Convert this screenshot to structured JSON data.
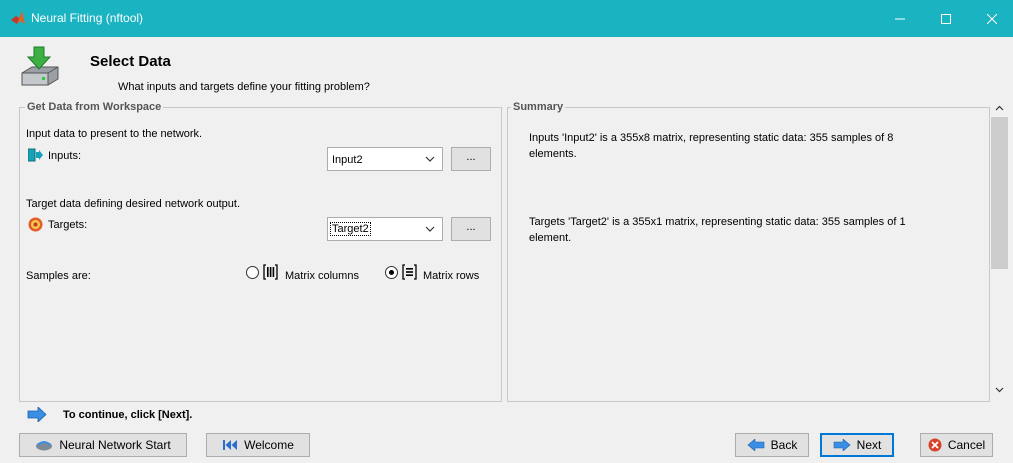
{
  "window": {
    "title": "Neural Fitting (nftool)"
  },
  "header": {
    "title": "Select Data",
    "subtitle": "What inputs and targets define your fitting problem?"
  },
  "left_panel": {
    "label": "Get Data from Workspace",
    "inputs_desc": "Input data to present to the network.",
    "inputs_label": "Inputs:",
    "inputs_value": "Input2",
    "inputs_browse": "...",
    "targets_desc": "Target data defining desired network output.",
    "targets_label": "Targets:",
    "targets_value": "Target2",
    "targets_browse": "...",
    "samples_label": "Samples are:",
    "option_columns": "Matrix columns",
    "option_rows": "Matrix rows",
    "selected_option": "rows"
  },
  "right_panel": {
    "label": "Summary",
    "inputs_summary_l1": "Inputs 'Input2' is a 355x8 matrix, representing static data: 355 samples of 8",
    "inputs_summary_l2": "elements.",
    "targets_summary_l1": "Targets 'Target2' is a 355x1 matrix, representing static data: 355 samples of 1",
    "targets_summary_l2": "element."
  },
  "footer": {
    "hint": "To continue, click [Next].",
    "nn_start": "Neural Network Start",
    "welcome": "Welcome",
    "back": "Back",
    "next": "Next",
    "cancel": "Cancel"
  },
  "colors": {
    "titlebar": "#1ab3c2",
    "accent": "#0078d7",
    "arrow": "#3a8ee6",
    "cancel_red": "#d9402a"
  },
  "icons": {
    "app": "matlab-icon",
    "header": "download-drive-icon",
    "inputs": "input-icon",
    "targets": "target-icon",
    "hint": "arrow-right-icon",
    "nn_start": "neural-network-icon",
    "welcome": "rewind-icon",
    "back": "arrow-left-icon",
    "next": "arrow-right-icon",
    "cancel": "cancel-icon"
  }
}
